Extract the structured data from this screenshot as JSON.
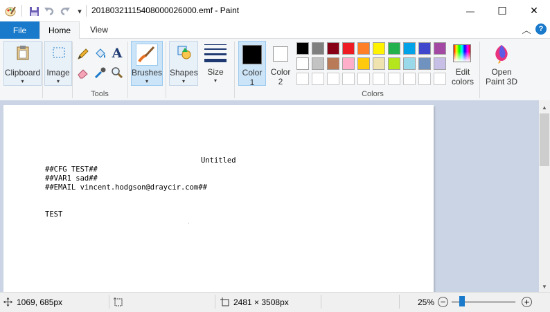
{
  "window": {
    "title": "20180321115408000026000.emf - Paint",
    "minimize_glyph": "—",
    "maximize_glyph": "☐",
    "close_glyph": "✕"
  },
  "quick_access": {
    "app_icon": "paint-palette-icon",
    "save_icon": "save-icon",
    "undo_icon": "undo-icon",
    "redo_icon": "redo-icon",
    "customize_glyph": "▾"
  },
  "tabs": {
    "file": "File",
    "home": "Home",
    "view": "View"
  },
  "ribbon": {
    "clipboard_label": "Clipboard",
    "image_label": "Image",
    "tools_label": "Tools",
    "brushes_label": "Brushes",
    "shapes_label": "Shapes",
    "size_label": "Size",
    "color1_label": "Color",
    "color1_num": "1",
    "color2_label": "Color",
    "color2_num": "2",
    "colors_group_label": "Colors",
    "edit_colors_line1": "Edit",
    "edit_colors_line2": "colors",
    "open_paint3d_line1": "Open",
    "open_paint3d_line2": "Paint 3D",
    "dropdown_glyph": "▾",
    "text_tool_glyph": "A",
    "collapse_glyph": "︿",
    "help_glyph": "?"
  },
  "colors": {
    "color1": "#000000",
    "color2": "#ffffff",
    "palette_row1": [
      "#000000",
      "#7f7f7f",
      "#880015",
      "#ed1c24",
      "#ff7f27",
      "#fff200",
      "#22b14c",
      "#00a2e8",
      "#3f48cc",
      "#a349a4"
    ],
    "palette_row2": [
      "#ffffff",
      "#c3c3c3",
      "#b97a57",
      "#ffaec9",
      "#ffc90e",
      "#efe4b0",
      "#b5e61d",
      "#99d9ea",
      "#7092be",
      "#c8bfe7"
    ],
    "workspace_bg": "#cad4e5",
    "accent": "#1979ca"
  },
  "document": {
    "heading": "Untitled",
    "line1": "##CFG TEST##",
    "line2": "##VAR1 sad##",
    "line3": "##EMAIL vincent.hodgson@draycir.com##",
    "line4": "TEST"
  },
  "statusbar": {
    "cursor_position": "1069, 685px",
    "image_size": "2481 × 3508px",
    "zoom": "25%",
    "zoom_level": 0.25,
    "zoom_out_glyph": "−",
    "zoom_in_glyph": "+"
  }
}
